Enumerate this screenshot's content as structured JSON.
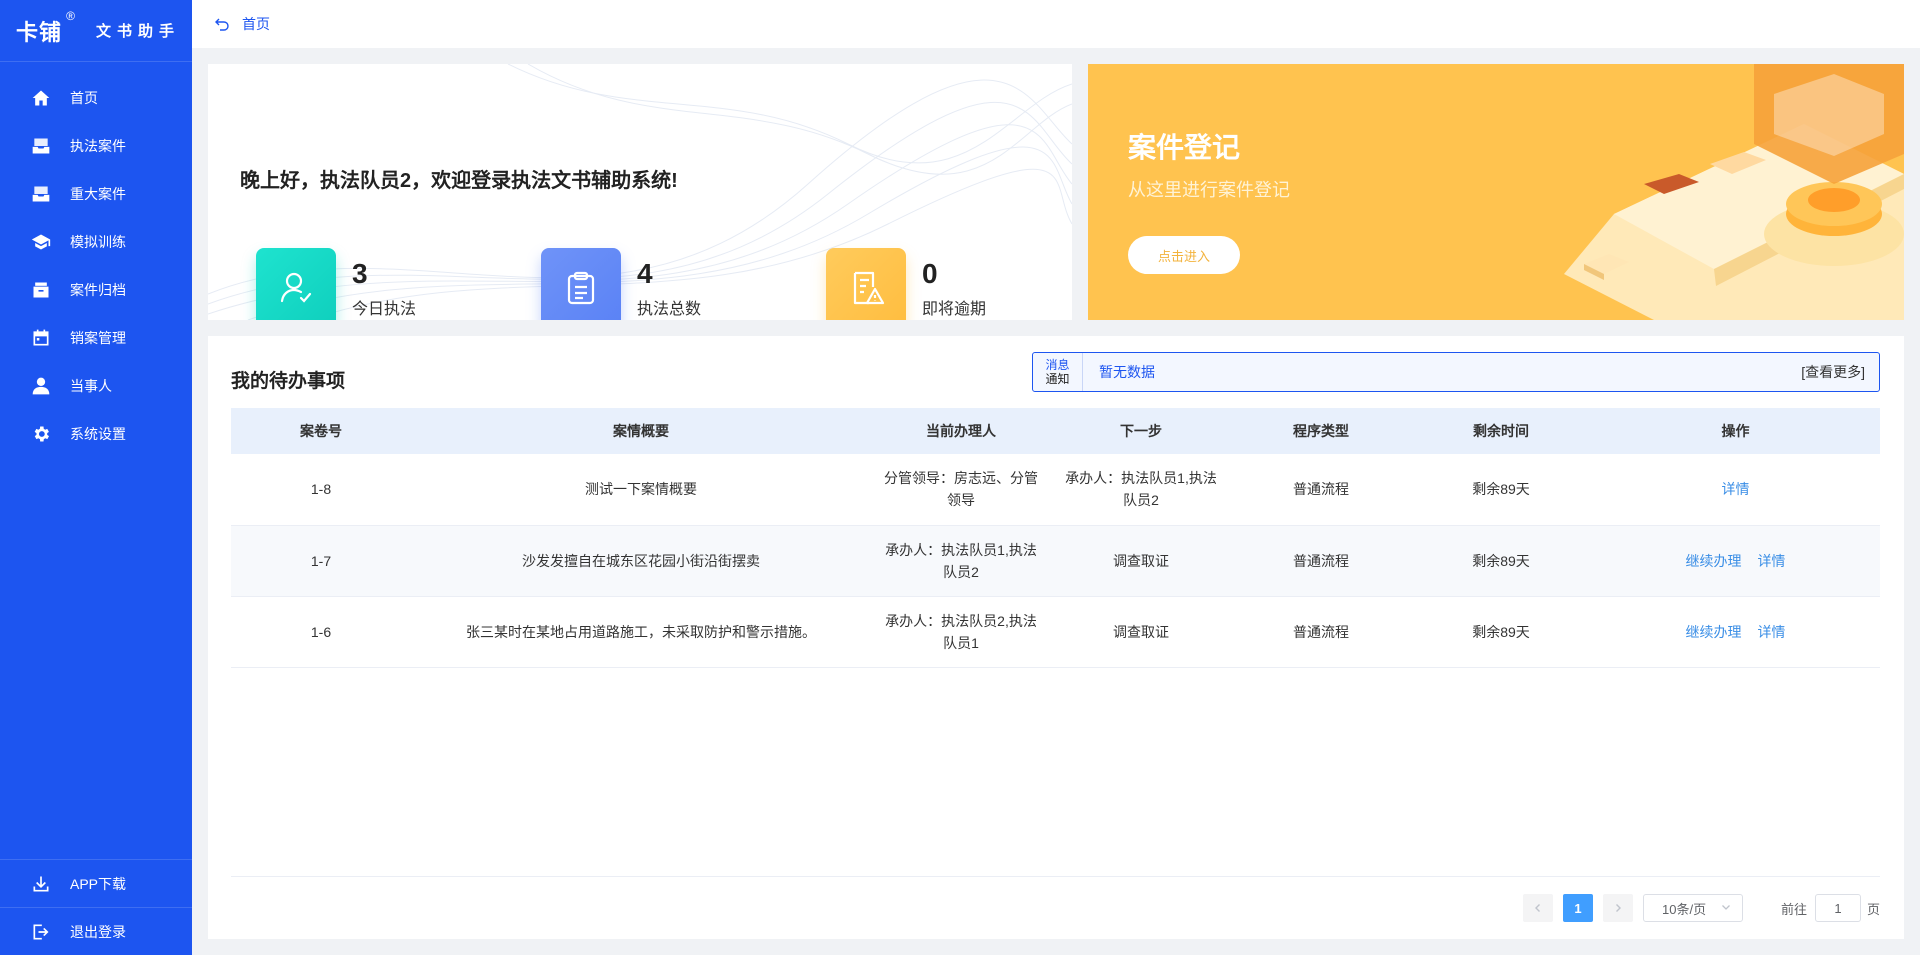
{
  "brand": {
    "logo": "卡铺",
    "reg": "®",
    "subtitle": "文书助手"
  },
  "sidebar": {
    "items": [
      {
        "label": "首页",
        "icon": "home-icon"
      },
      {
        "label": "执法案件",
        "icon": "case-box-icon"
      },
      {
        "label": "重大案件",
        "icon": "major-case-icon"
      },
      {
        "label": "模拟训练",
        "icon": "graduation-cap-icon"
      },
      {
        "label": "案件归档",
        "icon": "archive-icon"
      },
      {
        "label": "销案管理",
        "icon": "calendar-icon"
      },
      {
        "label": "当事人",
        "icon": "person-icon"
      },
      {
        "label": "系统设置",
        "icon": "gear-icon"
      }
    ],
    "bottom": [
      {
        "label": "APP下载",
        "icon": "download-icon"
      },
      {
        "label": "退出登录",
        "icon": "logout-icon"
      }
    ]
  },
  "topbar": {
    "breadcrumb": "首页"
  },
  "welcome": {
    "greeting": "晚上好，执法队员2，欢迎登录执法文书辅助系统!",
    "stats": [
      {
        "value": "3",
        "label": "今日执法",
        "icon": "person-check-icon"
      },
      {
        "value": "4",
        "label": "执法总数",
        "icon": "clipboard-icon"
      },
      {
        "value": "0",
        "label": "即将逾期",
        "icon": "document-warning-icon"
      }
    ]
  },
  "register": {
    "title": "案件登记",
    "subtitle": "从这里进行案件登记",
    "button": "点击进入"
  },
  "todo": {
    "title": "我的待办事项",
    "notice": {
      "tag_top": "消息",
      "tag_bottom": "通知",
      "message": "暂无数据",
      "more": "[查看更多]"
    },
    "columns": [
      "案卷号",
      "案情概要",
      "当前办理人",
      "下一步",
      "程序类型",
      "剩余时间",
      "操作"
    ],
    "rows": [
      {
        "id": "1-8",
        "summary": "测试一下案情概要",
        "handler": "分管领导：房志远、分管领导",
        "next": "承办人：执法队员1,执法队员2",
        "type": "普通流程",
        "remaining": "剩余89天",
        "actions": [
          "详情"
        ]
      },
      {
        "id": "1-7",
        "summary": "沙发发擅自在城东区花园小街沿街摆卖",
        "handler": "承办人：执法队员1,执法队员2",
        "next": "调查取证",
        "type": "普通流程",
        "remaining": "剩余89天",
        "actions": [
          "继续办理",
          "详情"
        ]
      },
      {
        "id": "1-6",
        "summary": "张三某时在某地占用道路施工，未采取防护和警示措施。",
        "handler": "承办人：执法队员2,执法队员1",
        "next": "调查取证",
        "type": "普通流程",
        "remaining": "剩余89天",
        "actions": [
          "继续办理",
          "详情"
        ]
      }
    ]
  },
  "pagination": {
    "current": "1",
    "page_size": "10条/页",
    "goto_prefix": "前往",
    "goto_value": "1",
    "goto_suffix": "页"
  },
  "colors": {
    "sidebar": "#1d55f0",
    "register_bg": "#ffc34f",
    "link": "#3a8ee6",
    "pager_active": "#409eff"
  }
}
